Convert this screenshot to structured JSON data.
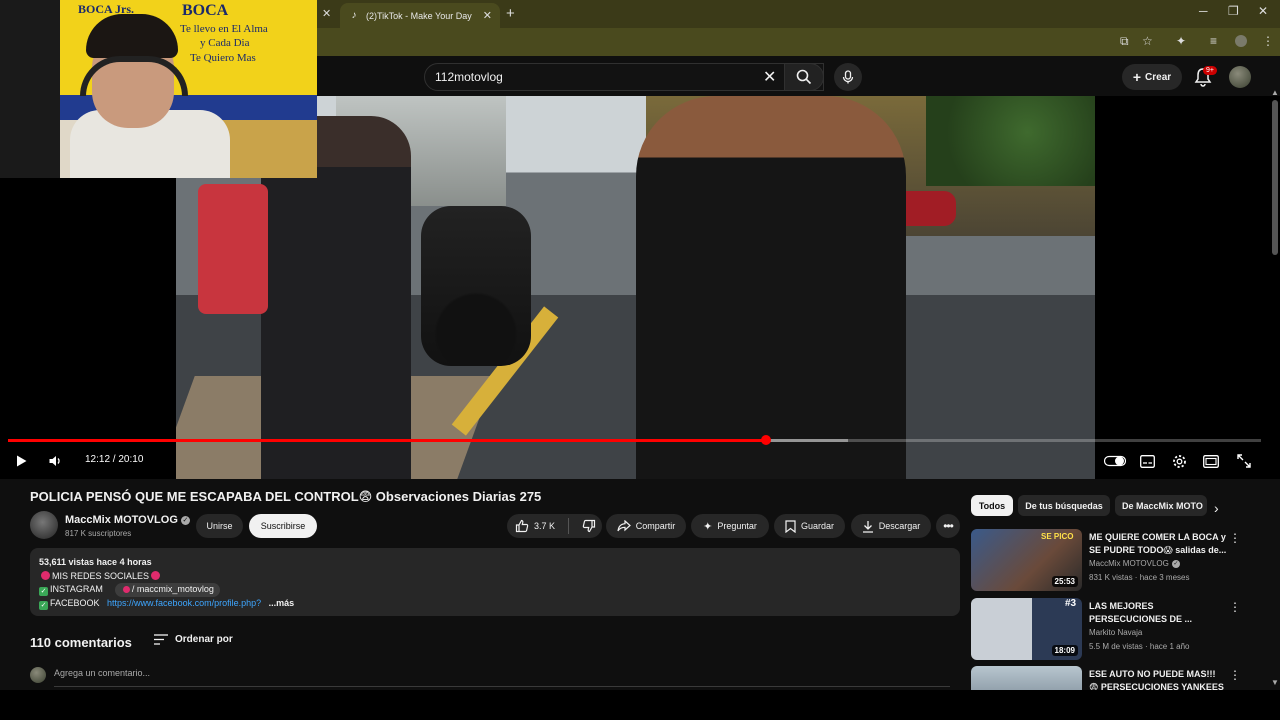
{
  "browser": {
    "tab_title": "(2)TikTok - Make Your Day",
    "tab_close": "✕",
    "new_tab": "+",
    "minimize": "─",
    "restore": "❐",
    "close": "✕"
  },
  "header": {
    "search_value": "112motovlog",
    "create_label": "Crear",
    "notifications_badge": "9+"
  },
  "webcam": {
    "flag_lines": [
      "BOCA Jrs.",
      "BOCA",
      "Te llevo en El Alma",
      "y Cada Dia",
      "Te Quiero Mas"
    ]
  },
  "player": {
    "current_time": "12:12",
    "duration": "20:10",
    "time_display": "12:12 / 20:10",
    "progress": 0.605,
    "buffered": 0.67,
    "colors": {
      "progress": "#ff0000"
    }
  },
  "video": {
    "title": "POLICIA PENSÓ QUE ME ESCAPABA DEL CONTROL😨 Observaciones Diarias 275",
    "channel_name": "MaccMix MOTOVLOG",
    "subscribers": "817 K suscriptores",
    "join_label": "Unirse",
    "subscribe_label": "Suscribirse",
    "likes": "3.7 K",
    "share_label": "Compartir",
    "ask_label": "Preguntar",
    "save_label": "Guardar",
    "download_label": "Descargar"
  },
  "description": {
    "stats": "53,611 vistas  hace 4 horas",
    "line1": "MIS REDES SOCIALES",
    "instagram_label": "INSTAGRAM",
    "instagram_handle": "/ maccmix_motovlog",
    "facebook_label": "FACEBOOK",
    "facebook_link": "https://www.facebook.com/profile.php?",
    "more": "...más"
  },
  "comments": {
    "count_label": "110 comentarios",
    "sort_label": "Ordenar por",
    "placeholder": "Agrega un comentario..."
  },
  "sidebar": {
    "chips": [
      "Todos",
      "De tus búsquedas",
      "De MaccMix MOTO"
    ],
    "recommendations": [
      {
        "title": "ME QUIERE COMER LA BOCA y SE PUDRE TODO😱 salidas de...",
        "channel": "MaccMix MOTOVLOG",
        "verified": true,
        "meta": "831 K vistas · hace 3 meses",
        "duration": "25:53",
        "thumb_text": "SE PICO"
      },
      {
        "title": "LAS MEJORES PERSECUCIONES DE ...",
        "channel": "Markito Navaja",
        "verified": false,
        "meta": "5.5 M de vistas · hace 1 año",
        "duration": "18:09",
        "thumb_text": "#3"
      },
      {
        "title": "ESE AUTO NO PUEDE MAS!!! 😨 PERSECUCIONES YANKEES ...",
        "channel": "",
        "verified": false,
        "meta": "",
        "duration": "",
        "thumb_text": ""
      }
    ]
  }
}
